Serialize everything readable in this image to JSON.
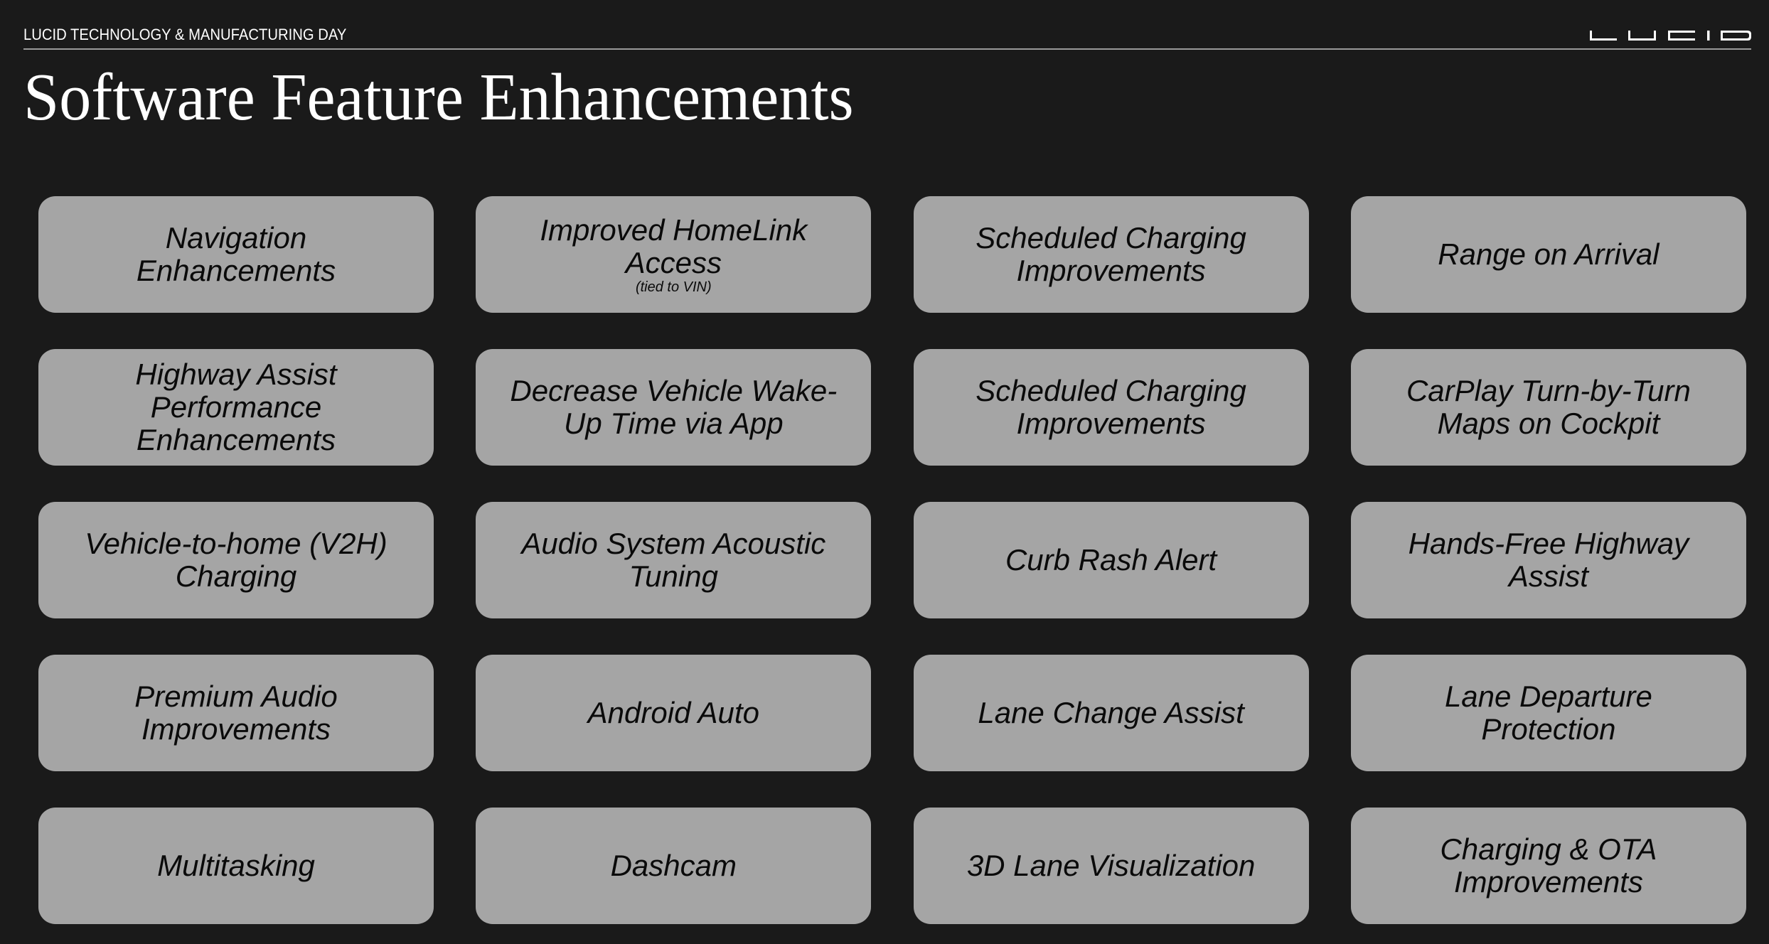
{
  "header": {
    "event_label": "LUCID TECHNOLOGY & MANUFACTURING DAY",
    "logo": "lucid-wordmark"
  },
  "page": {
    "title": "Software Feature Enhancements"
  },
  "colors": {
    "background": "#1a1a1a",
    "card": "#a5a5a5",
    "card_text": "#0a0a0a",
    "header_text": "#ffffff",
    "rule": "#9a9a9a"
  },
  "features": [
    {
      "title": "Navigation\nEnhancements",
      "note": ""
    },
    {
      "title": "Improved HomeLink\nAccess",
      "note": "(tied to VIN)"
    },
    {
      "title": "Scheduled Charging\nImprovements",
      "note": ""
    },
    {
      "title": "Range on Arrival",
      "note": ""
    },
    {
      "title": "Highway Assist\nPerformance\nEnhancements",
      "note": ""
    },
    {
      "title": "Decrease Vehicle Wake-\nUp Time via App",
      "note": ""
    },
    {
      "title": "Scheduled Charging\nImprovements",
      "note": ""
    },
    {
      "title": "CarPlay Turn-by-Turn\nMaps on Cockpit",
      "note": ""
    },
    {
      "title": "Vehicle-to-home (V2H)\nCharging",
      "note": ""
    },
    {
      "title": "Audio System Acoustic\nTuning",
      "note": ""
    },
    {
      "title": "Curb Rash Alert",
      "note": ""
    },
    {
      "title": "Hands-Free Highway\nAssist",
      "note": ""
    },
    {
      "title": "Premium Audio\nImprovements",
      "note": ""
    },
    {
      "title": "Android Auto",
      "note": ""
    },
    {
      "title": "Lane Change Assist",
      "note": ""
    },
    {
      "title": "Lane Departure\nProtection",
      "note": ""
    },
    {
      "title": "Multitasking",
      "note": ""
    },
    {
      "title": "Dashcam",
      "note": ""
    },
    {
      "title": "3D Lane Visualization",
      "note": ""
    },
    {
      "title": "Charging & OTA\nImprovements",
      "note": ""
    }
  ]
}
